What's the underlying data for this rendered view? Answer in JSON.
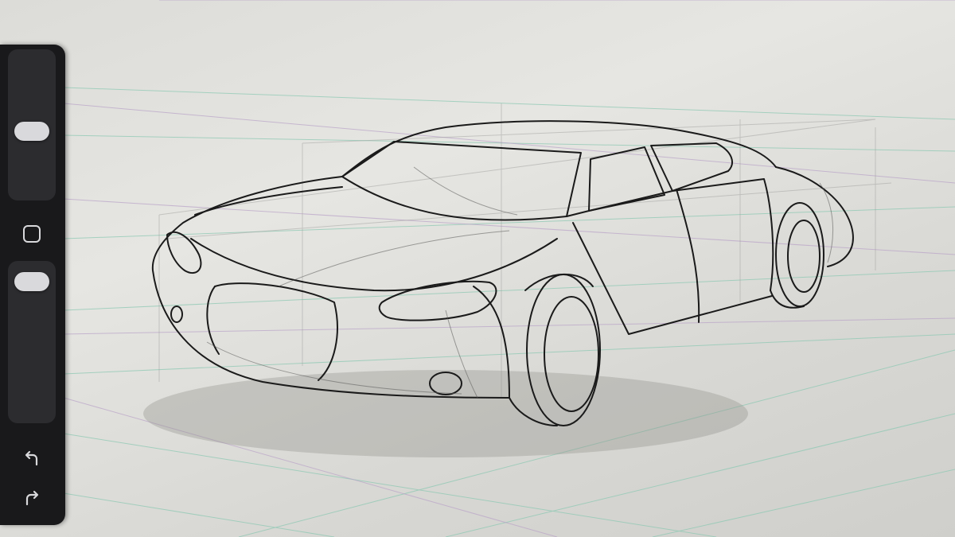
{
  "app": {
    "canvas": {
      "subject": "car-sketch",
      "paper_color": "#e2e2de",
      "line_color": "#1a1a1a",
      "guide_color_green": "#8fc9b4",
      "guide_color_purple": "#b9a3c8"
    },
    "toolbar": {
      "brush_size_level": 0.45,
      "opacity_level": 0.95,
      "icons": {
        "modify": "square-icon",
        "undo": "undo-arrow-icon",
        "redo": "redo-arrow-icon"
      },
      "background": "#19191b",
      "thumb_color": "#d9d9dc"
    }
  }
}
